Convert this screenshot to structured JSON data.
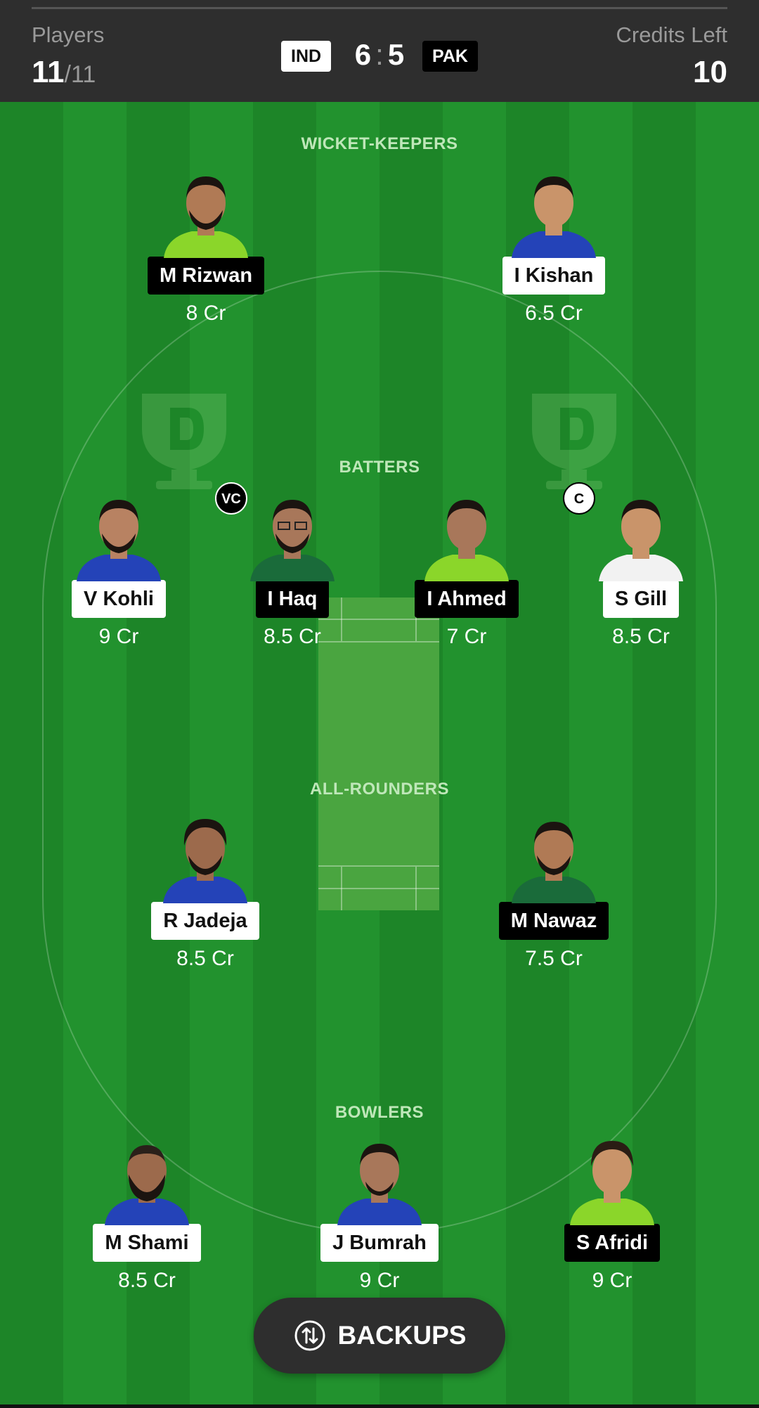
{
  "header": {
    "players_label": "Players",
    "players_selected": "11",
    "players_max": "/11",
    "team_left": "IND",
    "score_left": "6",
    "score_sep": ":",
    "score_right": "5",
    "team_right": "PAK",
    "credits_label": "Credits Left",
    "credits_value": "10"
  },
  "sections": {
    "wk": "WICKET-KEEPERS",
    "bat": "BATTERS",
    "ar": "ALL-ROUNDERS",
    "bowl": "BOWLERS"
  },
  "players": {
    "rizwan": {
      "name": "M Rizwan",
      "credit": "8 Cr",
      "team": "PAK"
    },
    "kishan": {
      "name": "I Kishan",
      "credit": "6.5 Cr",
      "team": "IND"
    },
    "kohli": {
      "name": "V Kohli",
      "credit": "9 Cr",
      "team": "IND"
    },
    "haq": {
      "name": "I Haq",
      "credit": "8.5 Cr",
      "team": "PAK"
    },
    "ahmed": {
      "name": "I Ahmed",
      "credit": "7 Cr",
      "team": "PAK"
    },
    "gill": {
      "name": "S Gill",
      "credit": "8.5 Cr",
      "team": "IND"
    },
    "jadeja": {
      "name": "R Jadeja",
      "credit": "8.5 Cr",
      "team": "IND"
    },
    "nawaz": {
      "name": "M Nawaz",
      "credit": "7.5 Cr",
      "team": "PAK"
    },
    "shami": {
      "name": "M Shami",
      "credit": "8.5 Cr",
      "team": "IND"
    },
    "bumrah": {
      "name": "J Bumrah",
      "credit": "9 Cr",
      "team": "IND"
    },
    "afridi": {
      "name": "S Afridi",
      "credit": "9 Cr",
      "team": "PAK"
    }
  },
  "badges": {
    "vc": "VC",
    "c": "C"
  },
  "backups_label": "BACKUPS",
  "colors": {
    "pitch_green": "#1d8528",
    "ind_jersey": "#2443b8",
    "pak_jersey": "#8bd62a",
    "header_bg": "#2e2e2e"
  }
}
